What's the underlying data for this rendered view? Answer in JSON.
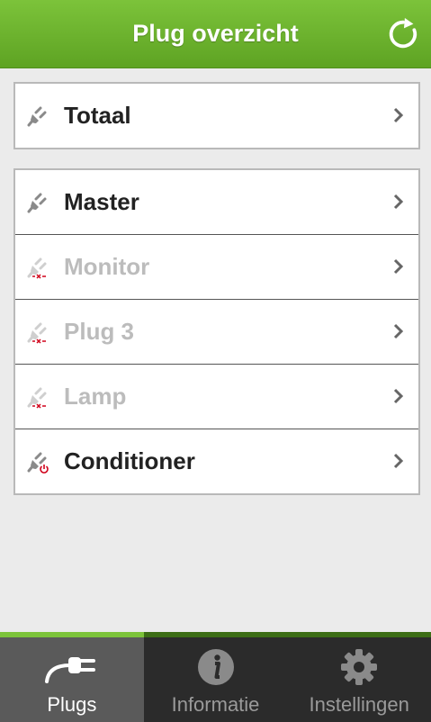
{
  "header": {
    "title": "Plug overzicht",
    "refresh_icon": "refresh-icon"
  },
  "groups": [
    {
      "items": [
        {
          "label": "Totaal",
          "state": "on"
        }
      ]
    },
    {
      "items": [
        {
          "label": "Master",
          "state": "on"
        },
        {
          "label": "Monitor",
          "state": "disconnected"
        },
        {
          "label": "Plug 3",
          "state": "disconnected"
        },
        {
          "label": "Lamp",
          "state": "disconnected"
        },
        {
          "label": "Conditioner",
          "state": "power-off"
        }
      ]
    }
  ],
  "tabs": [
    {
      "label": "Plugs",
      "icon": "plug-icon",
      "active": true
    },
    {
      "label": "Informatie",
      "icon": "info-icon",
      "active": false
    },
    {
      "label": "Instellingen",
      "icon": "gear-icon",
      "active": false
    }
  ],
  "colors": {
    "accent": "#7cc33a",
    "tabbar": "#2b2b2b",
    "active_tab": "#5a5a5a",
    "disabled_text": "#bcbcbc",
    "off_badge": "#d0021b"
  }
}
